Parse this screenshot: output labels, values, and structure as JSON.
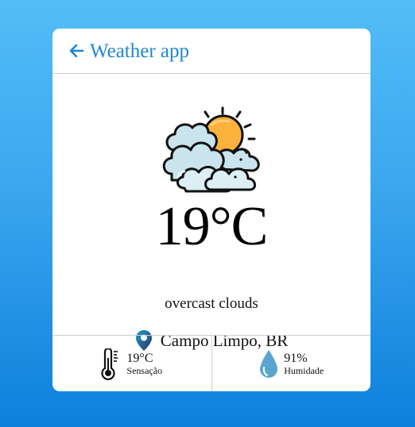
{
  "header": {
    "title": "Weather app",
    "back_icon": "arrow-left-icon"
  },
  "weather": {
    "icon": "partly-cloudy-sun-icon",
    "temperature": "19°C",
    "description": "overcast clouds",
    "location": "Campo Limpo, BR",
    "location_icon": "map-pin-icon"
  },
  "stats": [
    {
      "icon": "thermometer-icon",
      "value": "19°C",
      "label": "Sensação"
    },
    {
      "icon": "water-drop-icon",
      "value": "91%",
      "label": "Humidade"
    }
  ],
  "colors": {
    "accent": "#1f86d6",
    "background_top": "#53bdf7",
    "background_bottom": "#0e80dc",
    "sun": "#fbb13c",
    "cloud": "#c9e4ec",
    "drop": "#5aa5cf"
  }
}
